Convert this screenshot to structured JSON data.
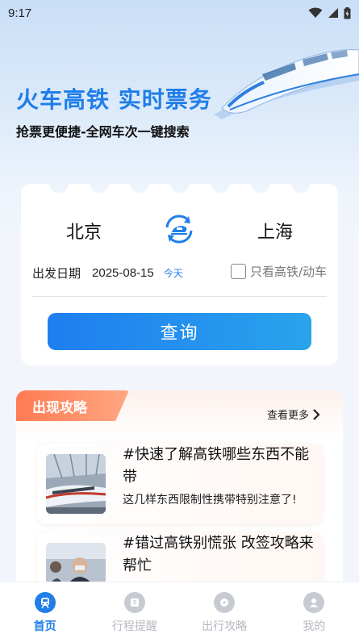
{
  "status_bar": {
    "time": "9:17"
  },
  "hero": {
    "title": "火车高铁 实时票务",
    "subtitle": "抢票更便捷-全网车次一键搜索"
  },
  "ticket": {
    "from_station": "北京",
    "to_station": "上海",
    "date_label": "出发日期",
    "date_value": "2025-08-15",
    "date_tag": "今天",
    "filter_label": "只看高铁/动车",
    "filter_checked": false,
    "query_button": "查询"
  },
  "guides": {
    "section_title": "出现攻略",
    "see_more": "查看更多",
    "articles": [
      {
        "title": "#快速了解高铁哪些东西不能带",
        "desc": "这几样东西限制性携带特别注意了!"
      },
      {
        "title": "#错过高铁别慌张 改签攻略来帮忙",
        "desc": ""
      }
    ]
  },
  "bottom_nav": {
    "items": [
      {
        "label": "首页",
        "icon": "train-icon",
        "active": true
      },
      {
        "label": "行程提醒",
        "icon": "reminder-icon",
        "active": false
      },
      {
        "label": "出行攻略",
        "icon": "guide-icon",
        "active": false
      },
      {
        "label": "我的",
        "icon": "profile-icon",
        "active": false
      }
    ]
  },
  "colors": {
    "accent": "#1f7ee8",
    "tag_orange": "#ff7b52",
    "nav_inactive": "#b5b9c0"
  }
}
